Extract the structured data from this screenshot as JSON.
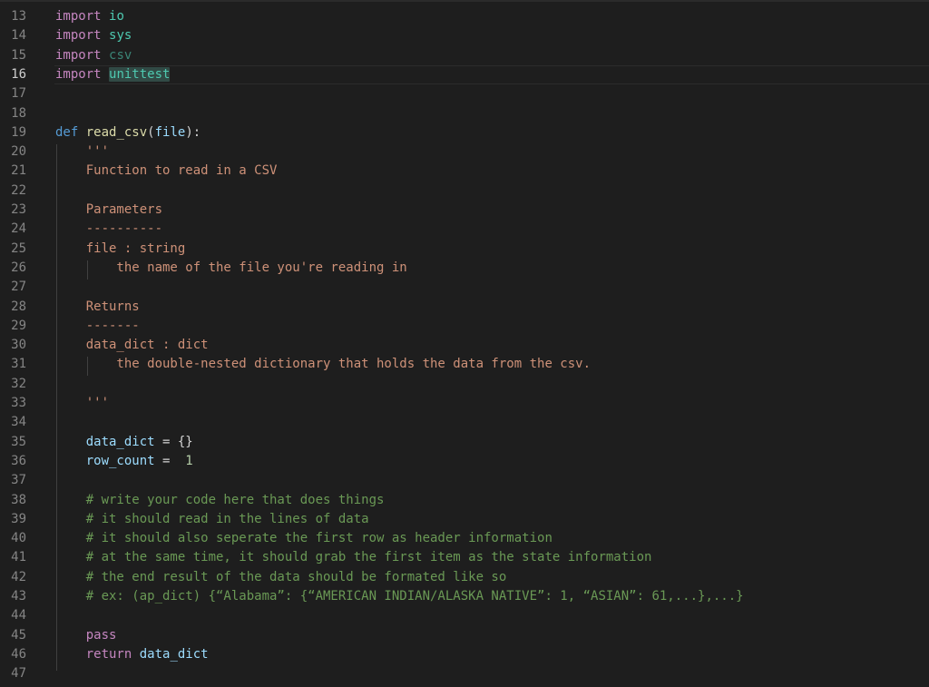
{
  "editor": {
    "active_line": "16",
    "lines": [
      {
        "num": "13",
        "tokens": [
          {
            "t": "import",
            "c": "kw"
          },
          {
            "t": " ",
            "c": "plain"
          },
          {
            "t": "io",
            "c": "mod"
          }
        ]
      },
      {
        "num": "14",
        "tokens": [
          {
            "t": "import",
            "c": "kw"
          },
          {
            "t": " ",
            "c": "plain"
          },
          {
            "t": "sys",
            "c": "mod"
          }
        ]
      },
      {
        "num": "15",
        "tokens": [
          {
            "t": "import",
            "c": "kw"
          },
          {
            "t": " ",
            "c": "plain"
          },
          {
            "t": "csv",
            "c": "mod-dim"
          }
        ]
      },
      {
        "num": "16",
        "tokens": [
          {
            "t": "import",
            "c": "kw"
          },
          {
            "t": " ",
            "c": "plain"
          },
          {
            "t": "unittest",
            "c": "mod hl"
          }
        ]
      },
      {
        "num": "17",
        "tokens": []
      },
      {
        "num": "18",
        "tokens": []
      },
      {
        "num": "19",
        "tokens": [
          {
            "t": "def",
            "c": "kwdef"
          },
          {
            "t": " ",
            "c": "plain"
          },
          {
            "t": "read_csv",
            "c": "fn"
          },
          {
            "t": "(",
            "c": "plain"
          },
          {
            "t": "file",
            "c": "var"
          },
          {
            "t": "):",
            "c": "plain"
          }
        ]
      },
      {
        "num": "20",
        "tokens": [
          {
            "t": "    '''",
            "c": "str"
          }
        ]
      },
      {
        "num": "21",
        "tokens": [
          {
            "t": "    Function to read in a CSV",
            "c": "str"
          }
        ]
      },
      {
        "num": "22",
        "tokens": []
      },
      {
        "num": "23",
        "tokens": [
          {
            "t": "    Parameters",
            "c": "str"
          }
        ]
      },
      {
        "num": "24",
        "tokens": [
          {
            "t": "    ----------",
            "c": "str"
          }
        ]
      },
      {
        "num": "25",
        "tokens": [
          {
            "t": "    file : string",
            "c": "str"
          }
        ]
      },
      {
        "num": "26",
        "tokens": [
          {
            "t": "        the name of the file you're reading in",
            "c": "str"
          }
        ]
      },
      {
        "num": "27",
        "tokens": []
      },
      {
        "num": "28",
        "tokens": [
          {
            "t": "    Returns",
            "c": "str"
          }
        ]
      },
      {
        "num": "29",
        "tokens": [
          {
            "t": "    -------",
            "c": "str"
          }
        ]
      },
      {
        "num": "30",
        "tokens": [
          {
            "t": "    data_dict : dict",
            "c": "str"
          }
        ]
      },
      {
        "num": "31",
        "tokens": [
          {
            "t": "        the double-nested dictionary that holds the data from the csv.",
            "c": "str"
          }
        ]
      },
      {
        "num": "32",
        "tokens": []
      },
      {
        "num": "33",
        "tokens": [
          {
            "t": "    '''",
            "c": "str"
          }
        ]
      },
      {
        "num": "34",
        "tokens": []
      },
      {
        "num": "35",
        "tokens": [
          {
            "t": "    ",
            "c": "plain"
          },
          {
            "t": "data_dict",
            "c": "var"
          },
          {
            "t": " = {}",
            "c": "plain"
          }
        ]
      },
      {
        "num": "36",
        "tokens": [
          {
            "t": "    ",
            "c": "plain"
          },
          {
            "t": "row_count",
            "c": "var"
          },
          {
            "t": " =  ",
            "c": "plain"
          },
          {
            "t": "1",
            "c": "num"
          }
        ]
      },
      {
        "num": "37",
        "tokens": []
      },
      {
        "num": "38",
        "tokens": [
          {
            "t": "    # write your code here that does things",
            "c": "cmt"
          }
        ]
      },
      {
        "num": "39",
        "tokens": [
          {
            "t": "    # it should read in the lines of data",
            "c": "cmt"
          }
        ]
      },
      {
        "num": "40",
        "tokens": [
          {
            "t": "    # it should also seperate the first row as header information",
            "c": "cmt"
          }
        ]
      },
      {
        "num": "41",
        "tokens": [
          {
            "t": "    # at the same time, it should grab the first item as the state information",
            "c": "cmt"
          }
        ]
      },
      {
        "num": "42",
        "tokens": [
          {
            "t": "    # the end result of the data should be formated like so",
            "c": "cmt"
          }
        ]
      },
      {
        "num": "43",
        "tokens": [
          {
            "t": "    # ex: (ap_dict) {“Alabama”: {“AMERICAN INDIAN/ALASKA NATIVE”: 1, “ASIAN”: 61,...},...}",
            "c": "cmt"
          }
        ]
      },
      {
        "num": "44",
        "tokens": []
      },
      {
        "num": "45",
        "tokens": [
          {
            "t": "    ",
            "c": "plain"
          },
          {
            "t": "pass",
            "c": "kw"
          }
        ]
      },
      {
        "num": "46",
        "tokens": [
          {
            "t": "    ",
            "c": "plain"
          },
          {
            "t": "return",
            "c": "kw"
          },
          {
            "t": " ",
            "c": "plain"
          },
          {
            "t": "data_dict",
            "c": "var"
          }
        ]
      },
      {
        "num": "47",
        "tokens": []
      }
    ]
  }
}
